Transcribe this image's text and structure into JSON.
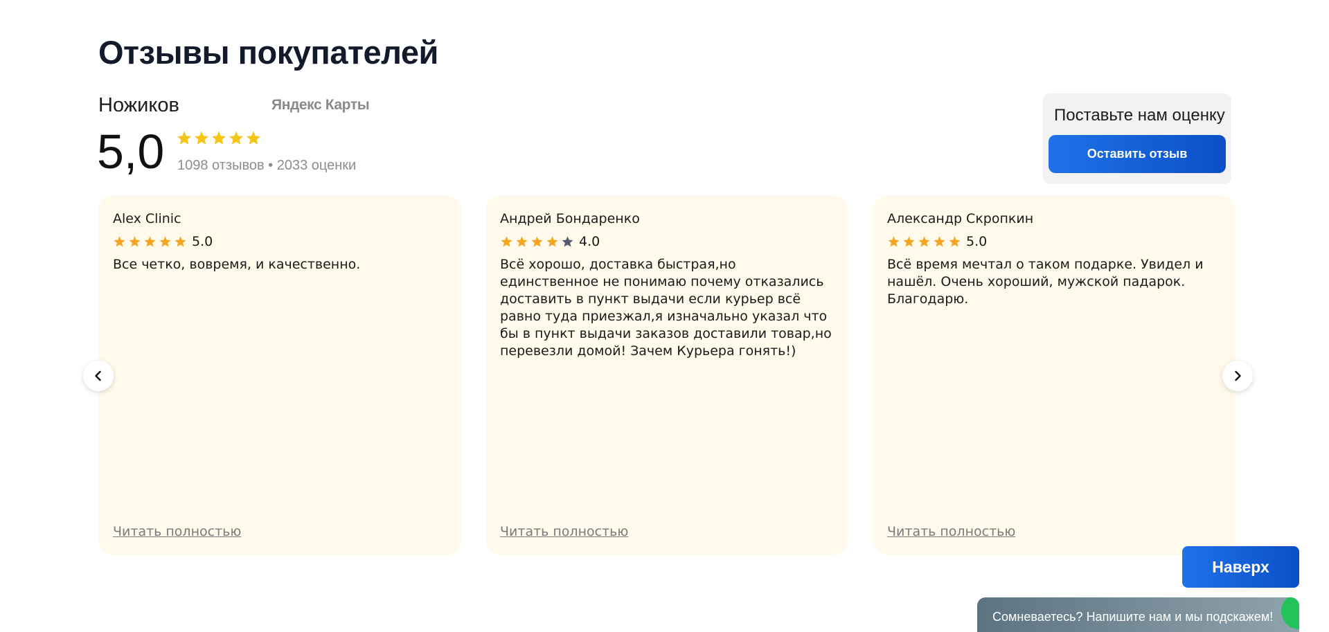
{
  "section": {
    "title": "Отзывы покупателей"
  },
  "summary": {
    "company": "Ножиков",
    "source": "Яндекс Карты",
    "score": "5,0",
    "stars": 5,
    "counts": "1098 отзывов • 2033 оценки"
  },
  "rate_box": {
    "title": "Поставьте нам оценку",
    "button": "Оставить отзыв"
  },
  "reviews": [
    {
      "author": "Alex Clinic",
      "rating": 5,
      "score": "5.0",
      "text": "Все четко, вовремя, и качественно.",
      "more": "Читать полностью"
    },
    {
      "author": "Андрей Бондаренко",
      "rating": 4,
      "score": "4.0",
      "text": "Всё хорошо, доставка быстрая,но единственное не понимаю почему отказались доставить в пункт выдачи если курьер всё равно туда приезжал,я изначально указал что бы в пункт выдачи заказов доставили товар,но перевезли домой! Зачем Курьера гонять!)",
      "more": "Читать полностью"
    },
    {
      "author": "Александр Скропкин",
      "rating": 5,
      "score": "5.0",
      "text": "Всё время мечтал о таком подарке. Увидел и нашёл. Очень хороший, мужской падарок. Благодарю.",
      "more": "Читать полностью"
    }
  ],
  "icons": {
    "prev": "chevron-left-icon",
    "next": "chevron-right-icon",
    "star": "star-icon"
  },
  "up_button": "Наверх",
  "chat_bar": "Сомневаетесь? Напишите нам и мы подскажем!",
  "colors": {
    "accent": "#1565e0",
    "star_gold": "#f5c518",
    "star_orange": "#f4a623",
    "star_empty": "#555b6e",
    "card_bg": "#fffaeb"
  }
}
